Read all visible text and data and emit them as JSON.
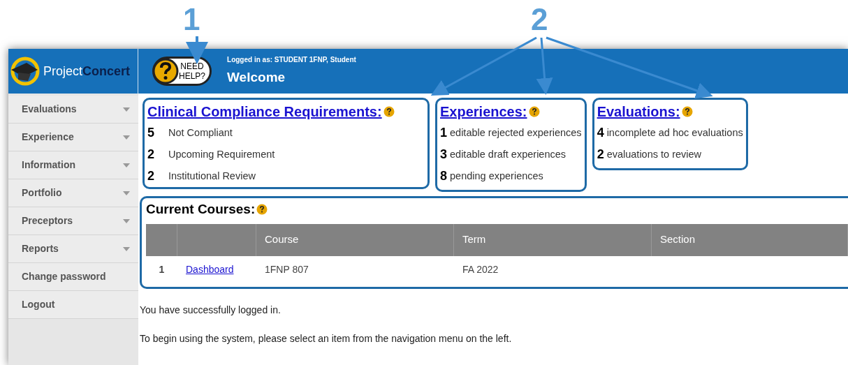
{
  "annotations": [
    {
      "label": "1"
    },
    {
      "label": "2"
    }
  ],
  "logo": {
    "first": "Project",
    "second": "Concert"
  },
  "need_help": {
    "lines": [
      "NEED",
      "HELP?"
    ]
  },
  "header": {
    "logged_in": "Logged in as: STUDENT 1FNP, Student",
    "title": "Welcome"
  },
  "sidebar": {
    "items": [
      {
        "label": "Evaluations",
        "expandable": true
      },
      {
        "label": "Experience",
        "expandable": true
      },
      {
        "label": "Information",
        "expandable": true
      },
      {
        "label": "Portfolio",
        "expandable": true
      },
      {
        "label": "Preceptors",
        "expandable": true
      },
      {
        "label": "Reports",
        "expandable": true
      },
      {
        "label": "Change password",
        "expandable": false
      },
      {
        "label": "Logout",
        "expandable": false
      }
    ]
  },
  "summaries": [
    {
      "title": "Clinical Compliance Requirements:",
      "rows": [
        {
          "count": "5",
          "text": "Not Compliant"
        },
        {
          "count": "2",
          "text": "Upcoming Requirement"
        },
        {
          "count": "2",
          "text": "Institutional Review"
        }
      ]
    },
    {
      "title": "Experiences:",
      "rows": [
        {
          "count": "1",
          "text": "editable rejected experiences"
        },
        {
          "count": "3",
          "text": "editable draft experiences"
        },
        {
          "count": "8",
          "text": "pending experiences"
        }
      ]
    },
    {
      "title": "Evaluations:",
      "rows": [
        {
          "count": "4",
          "text": "incomplete ad hoc evaluations"
        },
        {
          "count": "2",
          "text": "evaluations to review"
        }
      ]
    }
  ],
  "courses": {
    "title": "Current Courses:",
    "columns": [
      "Course",
      "Term",
      "Section"
    ],
    "rows": [
      {
        "number": "1",
        "link": "Dashboard",
        "course": "1FNP 807",
        "term": "FA 2022"
      }
    ]
  },
  "messages": [
    "You have successfully logged in.",
    "To begin using the system, please select an item from the navigation menu on the left."
  ]
}
